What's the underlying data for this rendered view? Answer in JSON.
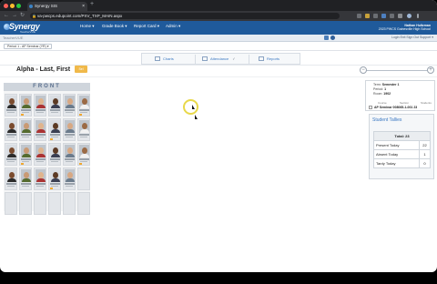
{
  "browser": {
    "tab_title": "Synergy SIS",
    "tab_close": "×",
    "new_tab": "+",
    "back": "←",
    "forward": "→",
    "reload": "↻",
    "url": "va-pwcps.edupoint.com/PXV_TXP_MAIN.aspx",
    "lock": "🔒"
  },
  "app": {
    "logo": "Synergy",
    "logo_sub": "TeacherVUE",
    "menu": [
      "Home ▾",
      "Grade Book ▾",
      "Report Card ▾",
      "Admin ▾"
    ],
    "user_name": "Nathan Hultzman",
    "user_school": "2023 PWCS Gainesville High School",
    "sub_title": "TeacherVUE",
    "links": "Login   Exit   Sign Out   Support ▾",
    "period": "Period 1 - AP Seminar (YR) ▾"
  },
  "tabs": [
    {
      "label": "Charts"
    },
    {
      "label": "Attendance"
    },
    {
      "label": "Reports"
    }
  ],
  "chart": {
    "title": "Alpha - Last, First",
    "sel_label": "Sel",
    "zoom_minus": "−",
    "zoom_plus": "+"
  },
  "seating": {
    "front_label": "FRONT"
  },
  "info": {
    "term_label": "Term",
    "term": "Semester 1",
    "period_label": "Period",
    "period": "1",
    "room_label": "Room",
    "room": "1902",
    "col_course": "Course",
    "col_section": "Section",
    "col_students": "Students",
    "course_row": "AP Seminar  008065-1-001  23"
  },
  "tallies": {
    "title": "Student Tallies",
    "total": "Total: 23",
    "rows": [
      {
        "label": "Present Today",
        "value": "22"
      },
      {
        "label": "Absent Today",
        "value": "1"
      },
      {
        "label": "Tardy Today",
        "value": "0"
      }
    ]
  }
}
